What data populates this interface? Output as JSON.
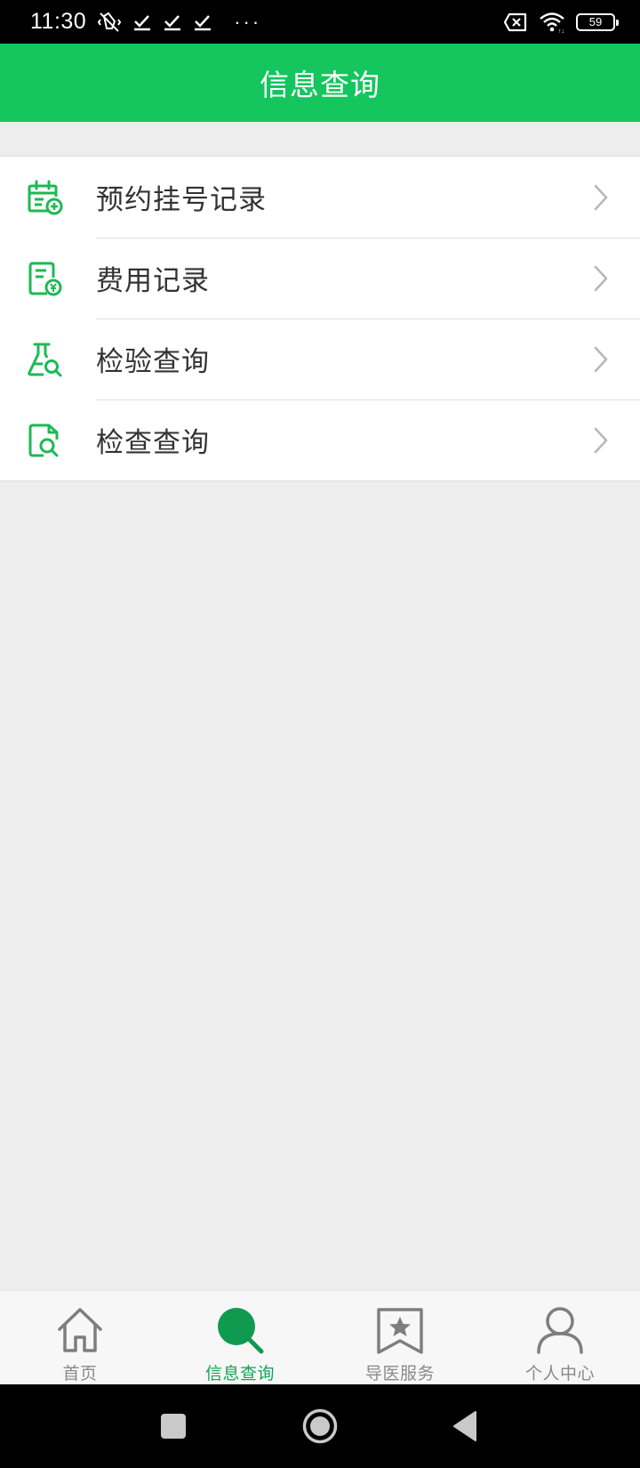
{
  "status_bar": {
    "time": "11:30",
    "dots": "···",
    "battery": "59",
    "icons": [
      "vibrate-off-icon",
      "check-icon",
      "check-icon",
      "check-icon",
      "sim-off-icon",
      "wifi-icon",
      "battery-icon"
    ]
  },
  "header": {
    "title": "信息查询"
  },
  "menu": {
    "items": [
      {
        "label": "预约挂号记录",
        "icon": "calendar-plus-icon"
      },
      {
        "label": "费用记录",
        "icon": "bill-icon"
      },
      {
        "label": "检验查询",
        "icon": "flask-search-icon"
      },
      {
        "label": "检查查询",
        "icon": "document-search-icon"
      }
    ]
  },
  "bottom_nav": {
    "items": [
      {
        "label": "首页",
        "icon": "home-icon",
        "active": false
      },
      {
        "label": "信息查询",
        "icon": "search-icon",
        "active": true
      },
      {
        "label": "导医服务",
        "icon": "bookmark-star-icon",
        "active": false
      },
      {
        "label": "个人中心",
        "icon": "user-icon",
        "active": false
      }
    ]
  },
  "colors": {
    "accent": "#15c55e",
    "active_nav": "#13a557",
    "icon_green": "#1db954",
    "inactive": "#8a8a8a"
  }
}
